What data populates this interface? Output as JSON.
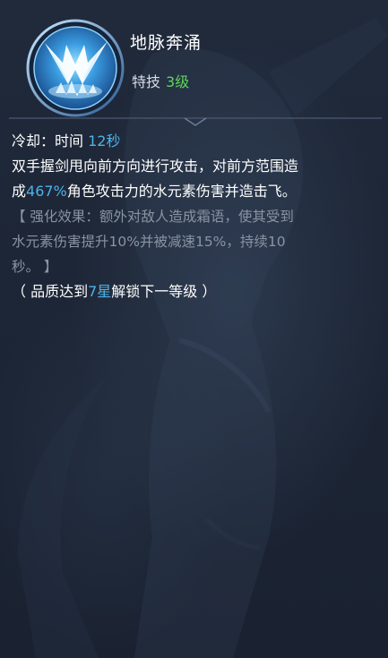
{
  "skill": {
    "name": "地脉奔涌",
    "type_label": "特技",
    "level": "3级",
    "icon": "blue-crystal-burst-icon"
  },
  "cooldown": {
    "label": "冷却：时间",
    "value": "12秒"
  },
  "description": {
    "line1": "双手握剑甩向前方向进行攻击，对前方范围造",
    "line2_prefix": "成",
    "line2_value": "467%",
    "line2_suffix": "角色攻击力的水元素伤害并造击飞。"
  },
  "enhancement": {
    "line1": "【 强化效果：额外对敌人造成霜语，使其受到",
    "line2": "水元素伤害提升10%并被减速15%，持续10",
    "line3": "秒。 】"
  },
  "unlock": {
    "prefix": "（ 品质达到",
    "star": "7星",
    "suffix": "解锁下一等级 ）"
  },
  "colors": {
    "highlight": "#4db3ea",
    "level_green": "#5fd45c",
    "muted_text": "#8994a3",
    "panel_bg": "#1d2636"
  }
}
